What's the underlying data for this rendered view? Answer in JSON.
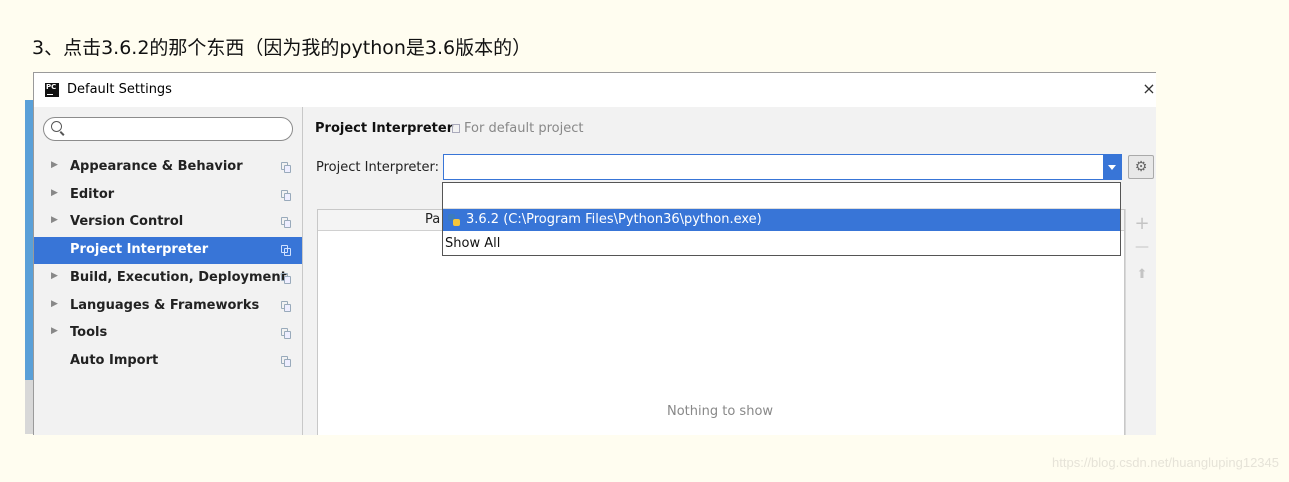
{
  "caption": "3、点击3.6.2的那个东西（因为我的python是3.6版本的）",
  "watermark": "https://blog.csdn.net/huangluping12345",
  "window": {
    "title": "Default Settings",
    "app_icon_text": "PC",
    "close_glyph": "×"
  },
  "sidebar": {
    "search_placeholder": "",
    "items": [
      {
        "label": "Appearance & Behavior",
        "has_arrow": true,
        "selected": false
      },
      {
        "label": "Editor",
        "has_arrow": true,
        "selected": false
      },
      {
        "label": "Version Control",
        "has_arrow": true,
        "selected": false
      },
      {
        "label": "Project Interpreter",
        "has_arrow": false,
        "selected": true
      },
      {
        "label": "Build, Execution, Deployment",
        "has_arrow": true,
        "selected": false
      },
      {
        "label": "Languages & Frameworks",
        "has_arrow": true,
        "selected": false
      },
      {
        "label": "Tools",
        "has_arrow": true,
        "selected": false
      },
      {
        "label": "Auto Import",
        "has_arrow": false,
        "selected": false
      }
    ],
    "arrow_glyph": "▶"
  },
  "main": {
    "heading": "Project Interpreter",
    "heading_sub": "For default project",
    "interpreter_label": "Project Interpreter:",
    "interpreter_value": "",
    "gear_glyph": "⚙",
    "table_header_partial": "Pa",
    "empty_text": "Nothing to show",
    "tools": {
      "add": "+",
      "remove": "—",
      "upgrade": "⬆"
    }
  },
  "dropdown": {
    "options": [
      {
        "label": "3.6.2 (C:\\Program Files\\Python36\\python.exe)",
        "selected": true,
        "icon": "python-icon"
      },
      {
        "label": "Show All",
        "selected": false
      }
    ]
  },
  "colors": {
    "selection": "#3875d7",
    "page_bg": "#fffdf0",
    "panel_bg": "#f2f2f2"
  }
}
